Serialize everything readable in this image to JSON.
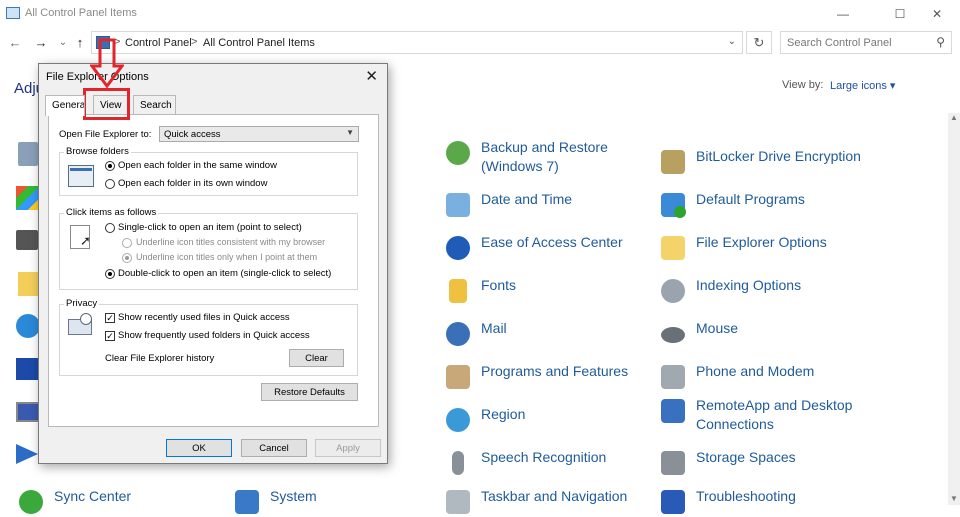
{
  "window": {
    "title": "All Control Panel Items",
    "minimize": "—",
    "maximize": "☐",
    "close": "✕"
  },
  "nav": {
    "back": "←",
    "forward": "→",
    "recent": "⌄",
    "up": "↑",
    "breadcrumb": [
      "Control Panel",
      "All Control Panel Items"
    ],
    "separator": ">",
    "dropdown": "⌄",
    "refresh": "↻",
    "search_placeholder": "Search Control Panel",
    "search_icon": "⚲"
  },
  "content": {
    "heading": "Adju",
    "view_by_label": "View by:",
    "view_by_value": "Large icons ▾"
  },
  "items": [
    {
      "label": "Backup and Restore (Windows 7)",
      "icon": "backup-restore-icon"
    },
    {
      "label": "BitLocker Drive Encryption",
      "icon": "bitlocker-icon"
    },
    {
      "label": "Date and Time",
      "icon": "date-time-icon"
    },
    {
      "label": "Default Programs",
      "icon": "default-programs-icon"
    },
    {
      "label": "Ease of Access Center",
      "icon": "ease-of-access-icon"
    },
    {
      "label": "File Explorer Options",
      "icon": "file-explorer-options-icon"
    },
    {
      "label": "Fonts",
      "icon": "fonts-icon"
    },
    {
      "label": "Indexing Options",
      "icon": "indexing-options-icon"
    },
    {
      "label": "Mail",
      "icon": "mail-icon"
    },
    {
      "label": "Mouse",
      "icon": "mouse-icon"
    },
    {
      "label": "Programs and Features",
      "icon": "programs-features-icon"
    },
    {
      "label": "Phone and Modem",
      "icon": "phone-modem-icon"
    },
    {
      "label": "Region",
      "icon": "region-icon"
    },
    {
      "label": "RemoteApp and Desktop Connections",
      "icon": "remoteapp-icon"
    },
    {
      "label": "Speech Recognition",
      "icon": "speech-recognition-icon"
    },
    {
      "label": "Storage Spaces",
      "icon": "storage-spaces-icon"
    },
    {
      "label": "Taskbar and Navigation",
      "icon": "taskbar-navigation-icon"
    },
    {
      "label": "Troubleshooting",
      "icon": "troubleshooting-icon"
    },
    {
      "label": "Sync Center",
      "icon": "sync-center-icon"
    },
    {
      "label": "System",
      "icon": "system-icon"
    }
  ],
  "dialog": {
    "title": "File Explorer Options",
    "close": "✕",
    "tabs": [
      "Genera",
      "View",
      "Search"
    ],
    "open_label": "Open File Explorer to:",
    "open_value": "Quick access",
    "browse": {
      "title": "Browse folders",
      "options": [
        "Open each folder in the same window",
        "Open each folder in its own window"
      ]
    },
    "click": {
      "title": "Click items as follows",
      "single": "Single-click to open an item (point to select)",
      "underline1": "Underline icon titles consistent with my browser",
      "underline2": "Underline icon titles only when I point at them",
      "double": "Double-click to open an item (single-click to select)"
    },
    "privacy": {
      "title": "Privacy",
      "recent": "Show recently used files in Quick access",
      "frequent": "Show frequently used folders in Quick access",
      "clear_label": "Clear File Explorer history",
      "clear_button": "Clear"
    },
    "restore_defaults": "Restore Defaults",
    "ok": "OK",
    "cancel": "Cancel",
    "apply": "Apply"
  },
  "colors": {
    "link": "#1f5b9a",
    "annotation": "#e0262b",
    "accent": "#0078d7"
  }
}
